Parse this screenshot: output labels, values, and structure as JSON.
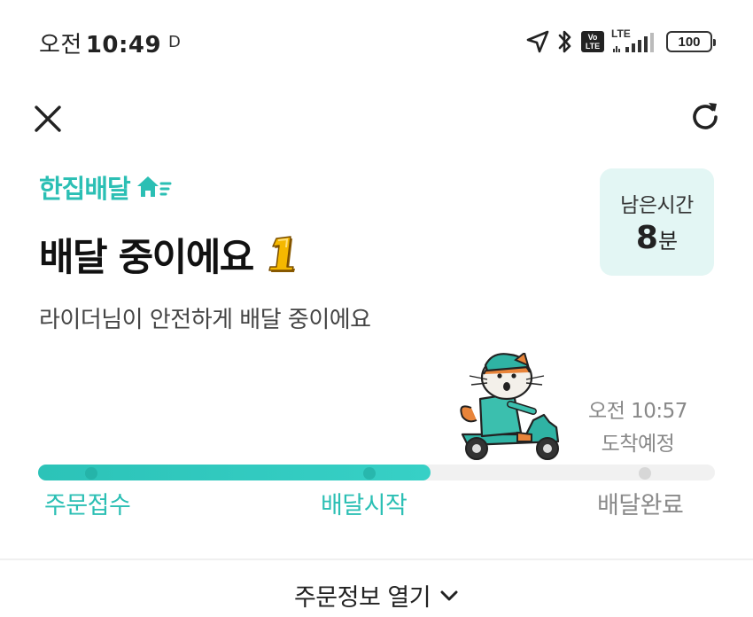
{
  "status_bar": {
    "ampm": "오전",
    "time": "10:49",
    "indicator": "D",
    "volte": "Vo LTE",
    "network": "LTE",
    "battery": "100"
  },
  "nav": {
    "close_icon": "close-icon",
    "refresh_icon": "refresh-icon"
  },
  "brand": {
    "name": "한집배달",
    "color": "#2bbfb4"
  },
  "header": {
    "title": "배달 중이에요",
    "subtitle": "라이더님이 안전하게 배달 중이에요"
  },
  "remaining": {
    "label": "남은시간",
    "value": "8",
    "unit": "분"
  },
  "eta": {
    "time": "오전 10:57",
    "label": "도착예정"
  },
  "progress": {
    "fraction": 0.58,
    "steps": [
      {
        "label": "주문접수",
        "state": "done"
      },
      {
        "label": "배달시작",
        "state": "done"
      },
      {
        "label": "배달완료",
        "state": "todo"
      }
    ]
  },
  "footer": {
    "order_info_label": "주문정보 열기"
  },
  "colors": {
    "accent": "#2bbfb4",
    "accent_light": "#e3f6f4",
    "inactive": "#8a8a8a"
  }
}
